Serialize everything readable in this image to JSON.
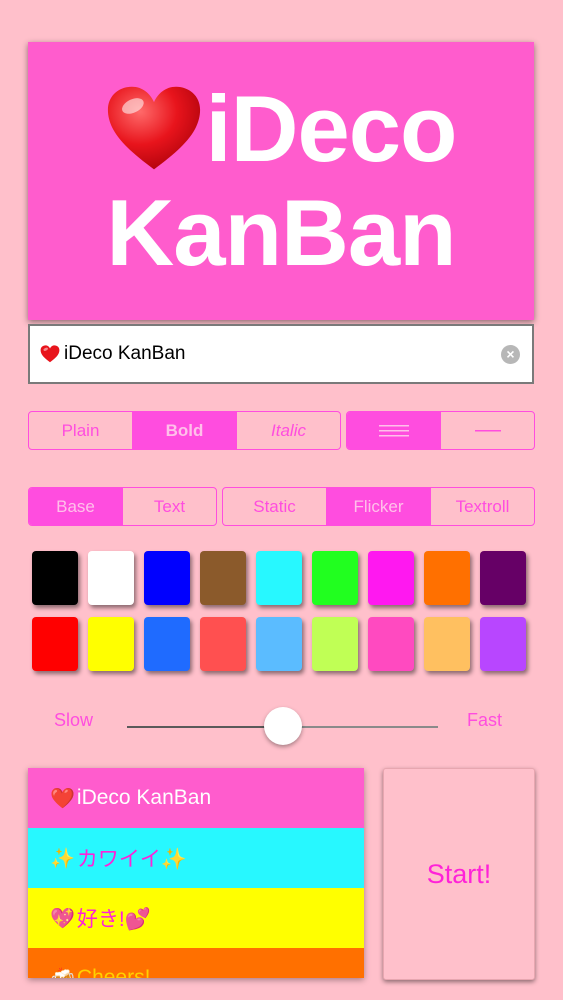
{
  "preview": {
    "line1": "iDeco",
    "line2": "KanBan",
    "background": "#ff5ccd",
    "text_color": "#ffffff"
  },
  "text_field": {
    "value": "iDeco KanBan",
    "clear_icon": "clear-circle-icon"
  },
  "font_style": {
    "options": [
      "Plain",
      "Bold",
      "Italic"
    ],
    "selected": "Bold"
  },
  "text_layout": {
    "options": [
      "multi-line-icon",
      "single-line-icon"
    ],
    "selected": "multi-line-icon"
  },
  "color_target": {
    "options": [
      "Base",
      "Text"
    ],
    "selected": "Base"
  },
  "animation": {
    "options": [
      "Static",
      "Flicker",
      "Textroll"
    ],
    "selected": "Flicker"
  },
  "palette": {
    "row1": [
      "#000000",
      "#ffffff",
      "#0000ff",
      "#8b5a2b",
      "#27f8ff",
      "#21ff1f",
      "#ff18f0",
      "#ff7000",
      "#660066"
    ],
    "row2": [
      "#ff0000",
      "#ffff00",
      "#1f6bff",
      "#ff5050",
      "#5bbcff",
      "#c0ff55",
      "#ff4ac0",
      "#ffc060",
      "#b846ff"
    ]
  },
  "speed": {
    "slow_label": "Slow",
    "fast_label": "Fast",
    "value": 0.5
  },
  "history": [
    {
      "emoji": "❤️",
      "text": "iDeco KanBan",
      "background": "#ff5ccd",
      "color": "#ffffff"
    },
    {
      "emoji": "✨",
      "text": "カワイイ✨",
      "background": "#27f8ff",
      "color": "#ff22d8"
    },
    {
      "emoji": "💖",
      "text": "好き!💕",
      "background": "#ffff00",
      "color": "#ff22d8"
    },
    {
      "emoji": "🍻",
      "text": "Cheers!",
      "background": "#ff7000",
      "color": "#ffd000"
    }
  ],
  "start_button": {
    "label": "Start!"
  }
}
